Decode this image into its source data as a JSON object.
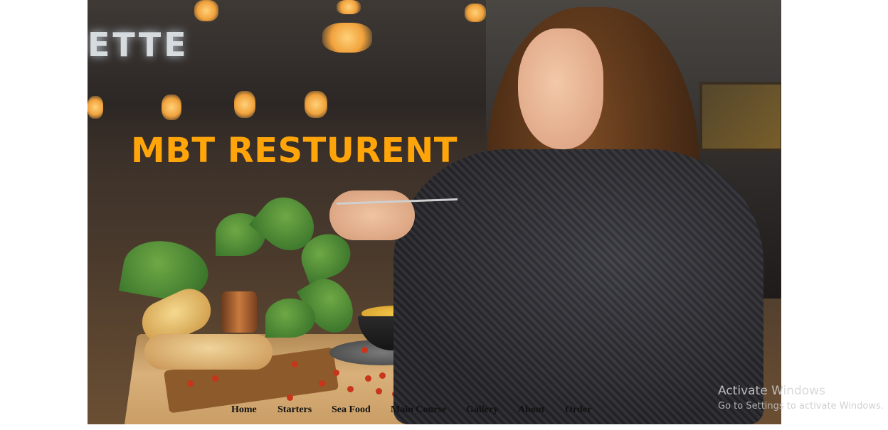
{
  "hero": {
    "title": "MBT RESTURENT",
    "background_sign_text": "ETTE",
    "image_subject": "woman-eating-at-cafe-photo"
  },
  "nav": {
    "items": [
      {
        "label": "Home"
      },
      {
        "label": "Starters"
      },
      {
        "label": "Sea Food"
      },
      {
        "label": "Main Course"
      },
      {
        "label": "Gallery"
      },
      {
        "label": "About"
      },
      {
        "label": "Order"
      }
    ]
  },
  "os_watermark": {
    "line1": "Activate Windows",
    "line2": "Go to Settings to activate Windows."
  },
  "colors": {
    "title": "#ffa50a",
    "nav_text": "#111111",
    "page_background": "#ffffff"
  }
}
